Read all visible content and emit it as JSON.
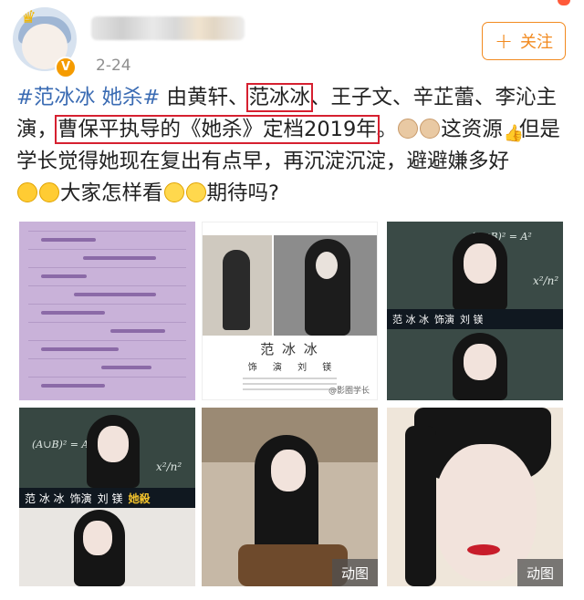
{
  "header": {
    "date": "2-24",
    "follow_label": "关注",
    "follow_icon": "plus-icon",
    "verified_icon": "v-badge-icon",
    "verified_letter": "V",
    "accent_color": "#f28a1f"
  },
  "post": {
    "hashtag": "#范冰冰 她杀#",
    "seg1": " 由黄轩、",
    "highlight1": "范冰冰",
    "seg2": "、王子文、辛芷蕾、李沁主演，",
    "highlight2": "曹保平执导的《她杀》定档2019年",
    "seg3": "。",
    "seg4": "这资源",
    "seg5": "但是学长觉得她现在复出有点早，再沉淀沉淀，避避嫌多好",
    "seg6": "大家怎样看",
    "seg7": "期待吗?",
    "hashtag_color": "#3a6bb3",
    "highlight_color": "#d62030"
  },
  "images": {
    "poster_name": "范 冰 冰",
    "poster_role": "饰 演",
    "poster_role_name": "刘 镁",
    "poster_watermark": "@影圈学长",
    "banner_name": "范 冰 冰",
    "banner_role": "饰演",
    "banner_role_name": "刘 镁",
    "banner_title": "她殺",
    "board_formula_1": "(A∪B)² = A²",
    "board_formula_2": "x²/n²",
    "gif_label_1": "动图",
    "gif_label_2": "动图"
  }
}
